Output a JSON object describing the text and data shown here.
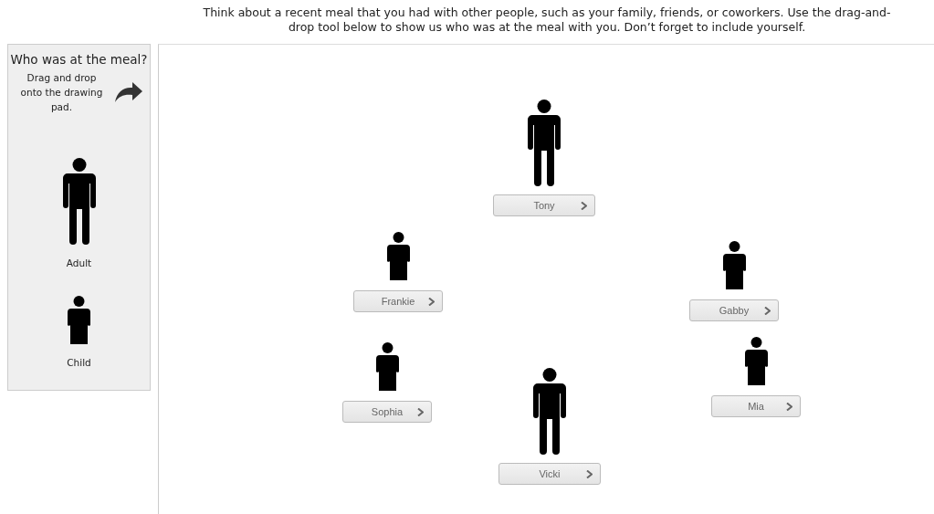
{
  "instructions": "Think about a recent meal that you had with other people, such as your family, friends, or coworkers. Use the drag-and-drop tool below to show us who was at the meal with you. Don’t forget to include yourself.",
  "palette": {
    "title": "Who was at the meal?",
    "hint": "Drag and drop onto the drawing pad.",
    "items": [
      {
        "kind": "adult",
        "label": "Adult"
      },
      {
        "kind": "child",
        "label": "Child"
      }
    ]
  },
  "people": [
    {
      "kind": "adult",
      "name": "Tony"
    },
    {
      "kind": "child",
      "name": "Frankie"
    },
    {
      "kind": "child",
      "name": "Gabby"
    },
    {
      "kind": "child",
      "name": "Sophia"
    },
    {
      "kind": "child",
      "name": "Mia"
    },
    {
      "kind": "adult",
      "name": "Vicki"
    }
  ]
}
